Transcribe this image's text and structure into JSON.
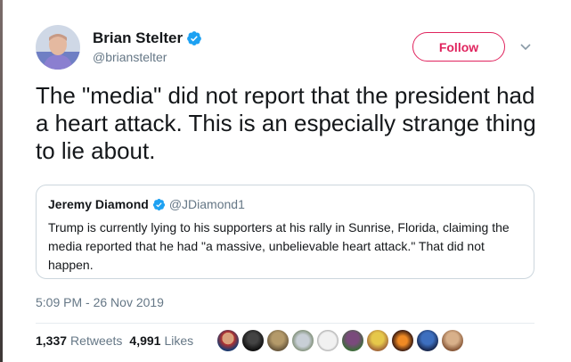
{
  "author": {
    "name": "Brian Stelter",
    "handle": "@brianstelter"
  },
  "follow_button": {
    "label": "Follow"
  },
  "tweet": {
    "text": "The \"media\" did not report that the president had a heart attack. This is an especially strange thing to lie about."
  },
  "quoted_tweet": {
    "name": "Jeremy Diamond",
    "handle": "@JDiamond1",
    "text": "Trump is currently lying to his supporters at his rally in Sunrise, Florida, claiming the media reported that he had \"a massive, unbelievable heart attack.\" That did not happen."
  },
  "timestamp": "5:09 PM - 26 Nov 2019",
  "stats": {
    "retweets_count": "1,337",
    "retweets_label": "Retweets",
    "likes_count": "4,991",
    "likes_label": "Likes"
  },
  "colors": {
    "follow_accent": "#e0245e",
    "verified_blue": "#1da1f2",
    "secondary_text": "#657786"
  },
  "icons": {
    "verified": "verified-badge-icon",
    "caret": "chevron-down-icon"
  }
}
